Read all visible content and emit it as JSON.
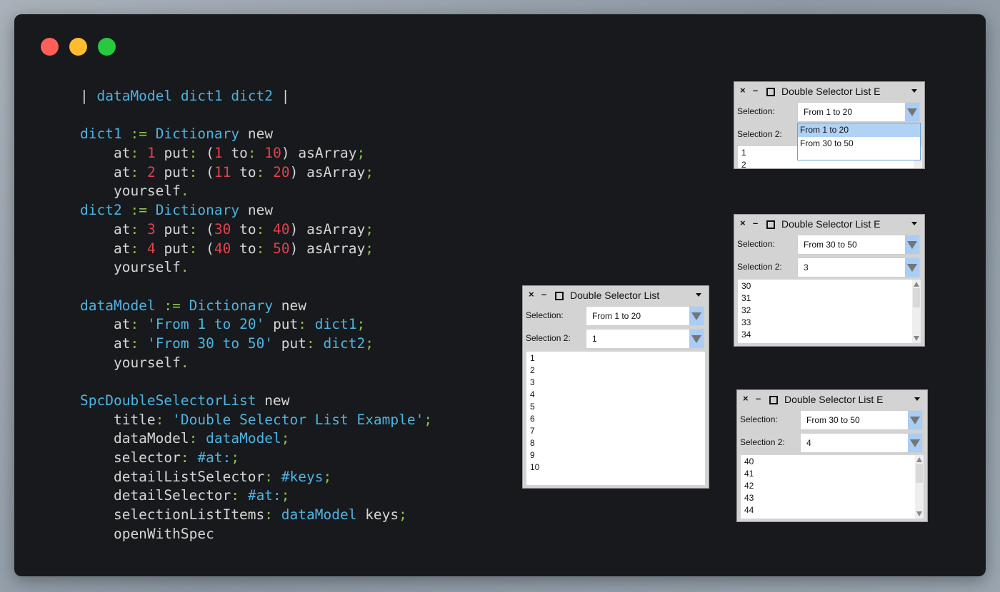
{
  "window_controls": [
    "close",
    "minimize",
    "maximize"
  ],
  "code_lines": [
    [
      [
        "pun2",
        "| "
      ],
      [
        "var",
        "dataModel dict1 dict2"
      ],
      [
        "pun2",
        " |"
      ]
    ],
    [],
    [
      [
        "var",
        "dict1"
      ],
      [
        "kw",
        " "
      ],
      [
        "op",
        ":="
      ],
      [
        "kw",
        " "
      ],
      [
        "var",
        "Dictionary"
      ],
      [
        "kw",
        " new"
      ]
    ],
    [
      [
        "kw",
        "    at"
      ],
      [
        "op",
        ":"
      ],
      [
        "kw",
        " "
      ],
      [
        "num",
        "1"
      ],
      [
        "kw",
        " put"
      ],
      [
        "op",
        ":"
      ],
      [
        "kw",
        " ("
      ],
      [
        "num",
        "1"
      ],
      [
        "kw",
        " to"
      ],
      [
        "op",
        ":"
      ],
      [
        "kw",
        " "
      ],
      [
        "num",
        "10"
      ],
      [
        "kw",
        ") asArray"
      ],
      [
        "op",
        ";"
      ]
    ],
    [
      [
        "kw",
        "    at"
      ],
      [
        "op",
        ":"
      ],
      [
        "kw",
        " "
      ],
      [
        "num",
        "2"
      ],
      [
        "kw",
        " put"
      ],
      [
        "op",
        ":"
      ],
      [
        "kw",
        " ("
      ],
      [
        "num",
        "11"
      ],
      [
        "kw",
        " to"
      ],
      [
        "op",
        ":"
      ],
      [
        "kw",
        " "
      ],
      [
        "num",
        "20"
      ],
      [
        "kw",
        ") asArray"
      ],
      [
        "op",
        ";"
      ]
    ],
    [
      [
        "kw",
        "    yourself"
      ],
      [
        "op",
        "."
      ]
    ],
    [
      [
        "var",
        "dict2"
      ],
      [
        "kw",
        " "
      ],
      [
        "op",
        ":="
      ],
      [
        "kw",
        " "
      ],
      [
        "var",
        "Dictionary"
      ],
      [
        "kw",
        " new"
      ]
    ],
    [
      [
        "kw",
        "    at"
      ],
      [
        "op",
        ":"
      ],
      [
        "kw",
        " "
      ],
      [
        "num",
        "3"
      ],
      [
        "kw",
        " put"
      ],
      [
        "op",
        ":"
      ],
      [
        "kw",
        " ("
      ],
      [
        "num",
        "30"
      ],
      [
        "kw",
        " to"
      ],
      [
        "op",
        ":"
      ],
      [
        "kw",
        " "
      ],
      [
        "num",
        "40"
      ],
      [
        "kw",
        ") asArray"
      ],
      [
        "op",
        ";"
      ]
    ],
    [
      [
        "kw",
        "    at"
      ],
      [
        "op",
        ":"
      ],
      [
        "kw",
        " "
      ],
      [
        "num",
        "4"
      ],
      [
        "kw",
        " put"
      ],
      [
        "op",
        ":"
      ],
      [
        "kw",
        " ("
      ],
      [
        "num",
        "40"
      ],
      [
        "kw",
        " to"
      ],
      [
        "op",
        ":"
      ],
      [
        "kw",
        " "
      ],
      [
        "num",
        "50"
      ],
      [
        "kw",
        ") asArray"
      ],
      [
        "op",
        ";"
      ]
    ],
    [
      [
        "kw",
        "    yourself"
      ],
      [
        "op",
        "."
      ]
    ],
    [],
    [
      [
        "var",
        "dataModel"
      ],
      [
        "kw",
        " "
      ],
      [
        "op",
        ":="
      ],
      [
        "kw",
        " "
      ],
      [
        "var",
        "Dictionary"
      ],
      [
        "kw",
        " new"
      ]
    ],
    [
      [
        "kw",
        "    at"
      ],
      [
        "op",
        ":"
      ],
      [
        "kw",
        " "
      ],
      [
        "str",
        "'From 1 to 20'"
      ],
      [
        "kw",
        " put"
      ],
      [
        "op",
        ":"
      ],
      [
        "kw",
        " "
      ],
      [
        "var",
        "dict1"
      ],
      [
        "op",
        ";"
      ]
    ],
    [
      [
        "kw",
        "    at"
      ],
      [
        "op",
        ":"
      ],
      [
        "kw",
        " "
      ],
      [
        "str",
        "'From 30 to 50'"
      ],
      [
        "kw",
        " put"
      ],
      [
        "op",
        ":"
      ],
      [
        "kw",
        " "
      ],
      [
        "var",
        "dict2"
      ],
      [
        "op",
        ";"
      ]
    ],
    [
      [
        "kw",
        "    yourself"
      ],
      [
        "op",
        "."
      ]
    ],
    [],
    [
      [
        "var",
        "SpcDoubleSelectorList"
      ],
      [
        "kw",
        " new"
      ]
    ],
    [
      [
        "kw",
        "    title"
      ],
      [
        "op",
        ":"
      ],
      [
        "kw",
        " "
      ],
      [
        "str",
        "'Double Selector List Example'"
      ],
      [
        "op",
        ";"
      ]
    ],
    [
      [
        "kw",
        "    dataModel"
      ],
      [
        "op",
        ":"
      ],
      [
        "kw",
        " "
      ],
      [
        "var",
        "dataModel"
      ],
      [
        "op",
        ";"
      ]
    ],
    [
      [
        "kw",
        "    selector"
      ],
      [
        "op",
        ":"
      ],
      [
        "kw",
        " "
      ],
      [
        "sym",
        "#at:"
      ],
      [
        "op",
        ";"
      ]
    ],
    [
      [
        "kw",
        "    detailListSelector"
      ],
      [
        "op",
        ":"
      ],
      [
        "kw",
        " "
      ],
      [
        "sym",
        "#keys"
      ],
      [
        "op",
        ";"
      ]
    ],
    [
      [
        "kw",
        "    detailSelector"
      ],
      [
        "op",
        ":"
      ],
      [
        "kw",
        " "
      ],
      [
        "sym",
        "#at:"
      ],
      [
        "op",
        ";"
      ]
    ],
    [
      [
        "kw",
        "    selectionListItems"
      ],
      [
        "op",
        ":"
      ],
      [
        "kw",
        " "
      ],
      [
        "var",
        "dataModel"
      ],
      [
        "kw",
        " keys"
      ],
      [
        "op",
        ";"
      ]
    ],
    [
      [
        "kw",
        "    openWithSpec"
      ]
    ]
  ],
  "windows": [
    {
      "title": "Double Selector List",
      "selection_label": "Selection:",
      "selection_value": "From 1 to 20",
      "selection2_label": "Selection 2:",
      "selection2_value": "1",
      "list_items": [
        "1",
        "2",
        "3",
        "4",
        "5",
        "6",
        "7",
        "8",
        "9",
        "10"
      ]
    },
    {
      "title": "Double Selector List E",
      "selection_label": "Selection:",
      "selection_value": "From 1 to 20",
      "selection2_label": "Selection 2:",
      "selection2_value": "",
      "list_items": [
        "1",
        "2"
      ],
      "popup_options": [
        "From 1 to 20",
        "From 30 to 50"
      ],
      "popup_selected": "From 1 to 20"
    },
    {
      "title": "Double Selector List E",
      "selection_label": "Selection:",
      "selection_value": "From 30 to 50",
      "selection2_label": "Selection 2:",
      "selection2_value": "3",
      "list_items": [
        "30",
        "31",
        "32",
        "33",
        "34"
      ]
    },
    {
      "title": "Double Selector List E",
      "selection_label": "Selection:",
      "selection_value": "From 30 to 50",
      "selection2_label": "Selection 2:",
      "selection2_value": "4",
      "list_items": [
        "40",
        "41",
        "42",
        "43",
        "44"
      ]
    }
  ],
  "icons": {
    "close": "×",
    "minimize": "–"
  },
  "colors": {
    "editor_bg": "#17191c",
    "identifier": "#4fb3e0",
    "operator": "#8fc549",
    "number": "#e0424a",
    "text": "#d6d6d6",
    "dropdown_button": "#a9cdf4",
    "popup_selected": "#afd2f5"
  }
}
